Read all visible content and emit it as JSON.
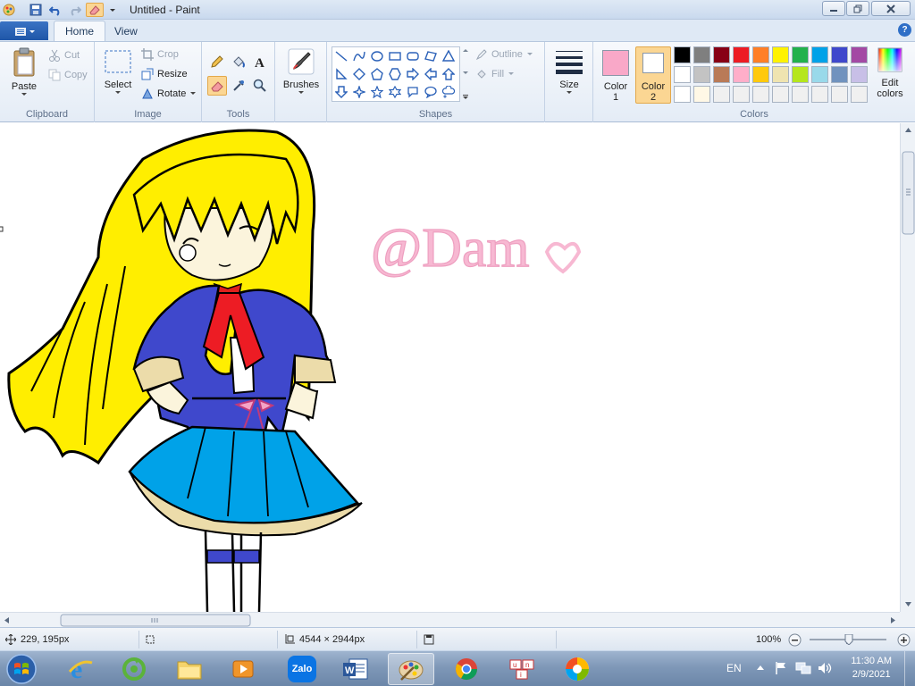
{
  "window": {
    "title": "Untitled - Paint"
  },
  "tabs": {
    "home": "Home",
    "view": "View"
  },
  "ribbon": {
    "clipboard": {
      "label": "Clipboard",
      "paste": "Paste",
      "cut": "Cut",
      "copy": "Copy"
    },
    "image": {
      "label": "Image",
      "select": "Select",
      "crop": "Crop",
      "resize": "Resize",
      "rotate": "Rotate"
    },
    "tools": {
      "label": "Tools"
    },
    "brushes": {
      "label": "Brushes"
    },
    "shapes": {
      "label": "Shapes",
      "outline": "Outline",
      "fill": "Fill"
    },
    "size": {
      "label": "Size"
    },
    "colors": {
      "label": "Colors",
      "color1_line1": "Color",
      "color1_line2": "1",
      "color2_line1": "Color",
      "color2_line2": "2",
      "edit_line1": "Edit",
      "edit_line2": "colors",
      "color1_value": "#f9a8c8",
      "color2_value": "#ffffff",
      "palette": [
        "#000000",
        "#7f7f7f",
        "#880015",
        "#ed1c24",
        "#ff7f27",
        "#fff200",
        "#22b14c",
        "#00a2e8",
        "#3f48cc",
        "#a349a4",
        "#ffffff",
        "#c3c3c3",
        "#b97a57",
        "#ffaec9",
        "#ffc90e",
        "#efe4b0",
        "#b5e61d",
        "#99d9ea",
        "#7092be",
        "#c8bfe7",
        "#ffffff",
        "#fff8e6",
        "#f0f0f0",
        "#f0f0f0",
        "#f0f0f0",
        "#f0f0f0",
        "#f0f0f0",
        "#f0f0f0",
        "#f0f0f0",
        "#f0f0f0"
      ]
    }
  },
  "canvas": {
    "watermark": "@Dam"
  },
  "statusbar": {
    "cursor": "229, 195px",
    "image_size": "4544 × 2944px",
    "zoom": "100%"
  },
  "taskbar": {
    "language": "EN",
    "time": "11:30 AM",
    "date": "2/9/2021",
    "zalo": "Zalo"
  }
}
